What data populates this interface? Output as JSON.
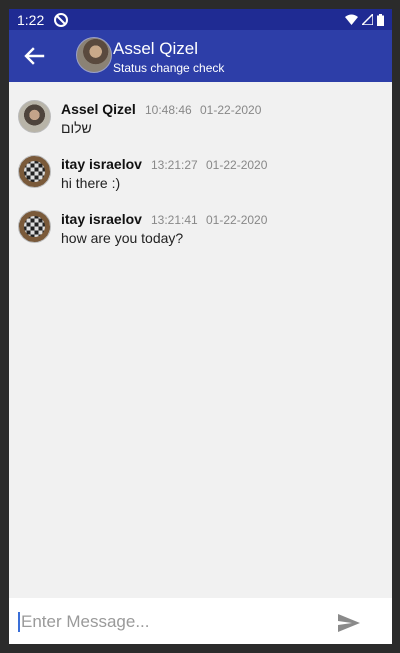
{
  "status_bar": {
    "time": "1:22"
  },
  "header": {
    "contact_name": "Assel Qizel",
    "status": "Status change check"
  },
  "messages": [
    {
      "sender": "Assel Qizel",
      "time": "10:48:46",
      "date": "01-22-2020",
      "text": "שלום",
      "avatar": "photo"
    },
    {
      "sender": "itay israelov",
      "time": "13:21:27",
      "date": "01-22-2020",
      "text": "hi there :)",
      "avatar": "chessboard"
    },
    {
      "sender": "itay israelov",
      "time": "13:21:41",
      "date": "01-22-2020",
      "text": "how are you today?",
      "avatar": "chessboard"
    }
  ],
  "composer": {
    "placeholder": "Enter Message...",
    "value": ""
  },
  "colors": {
    "status_bar": "#1f2b93",
    "app_bar": "#2d3ea8",
    "background": "#f1f1f1"
  }
}
